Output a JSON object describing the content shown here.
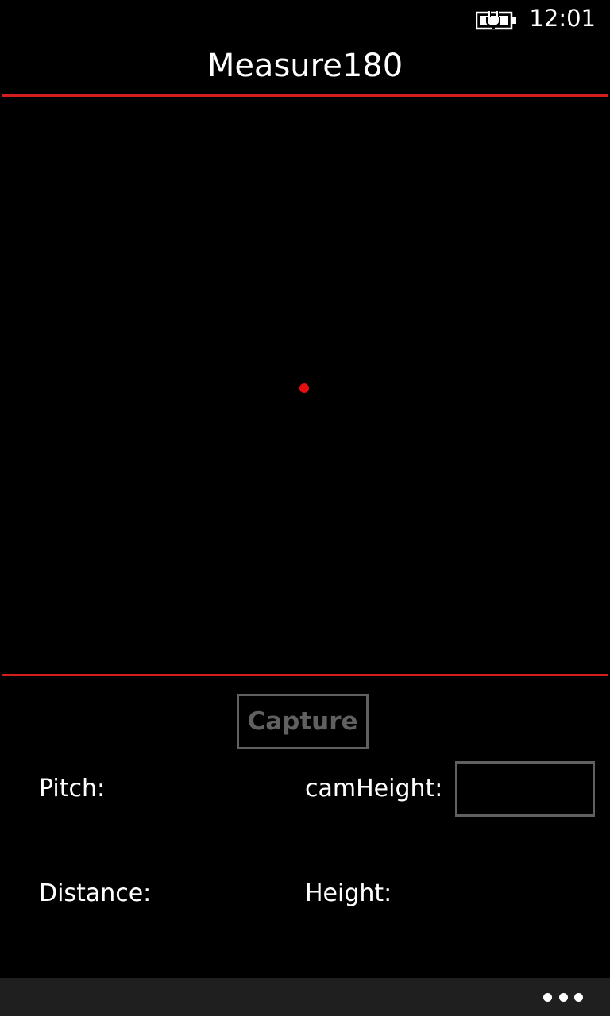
{
  "status_bar": {
    "time": "12:01",
    "battery_icon": "battery-charging-icon"
  },
  "app": {
    "title": "Measure180",
    "accent_color": "#d41d1d"
  },
  "viewfinder": {
    "crosshair_color": "#e50f0f"
  },
  "controls": {
    "capture_label": "Capture",
    "pitch_label": "Pitch:",
    "camheight_label": "camHeight:",
    "camheight_value": "",
    "distance_label": "Distance:",
    "height_label": "Height:"
  },
  "app_bar": {
    "more_icon": "more-options-icon"
  }
}
